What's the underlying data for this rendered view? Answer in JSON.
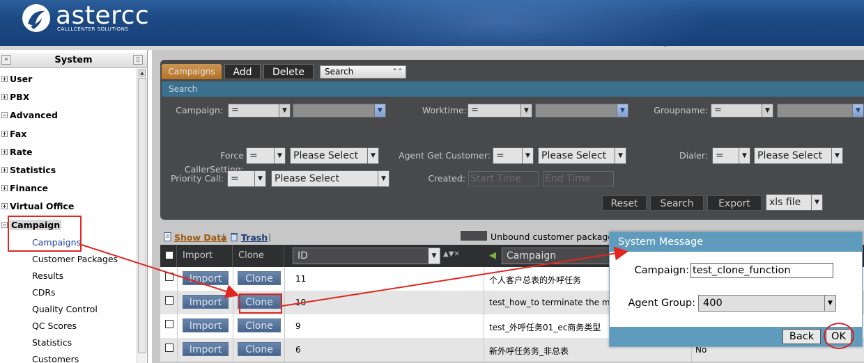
{
  "brand": {
    "name": "astercc",
    "tagline": "CALLLCENTER SOLUTIONS"
  },
  "left_panel": {
    "title": "System",
    "tree": [
      {
        "label": "User",
        "expanded": false
      },
      {
        "label": "PBX",
        "expanded": false
      },
      {
        "label": "Advanced",
        "expanded": true
      },
      {
        "label": "Fax",
        "expanded": false
      },
      {
        "label": "Rate",
        "expanded": false
      },
      {
        "label": "Statistics",
        "expanded": false
      },
      {
        "label": "Finance",
        "expanded": false
      },
      {
        "label": "Virtual Office",
        "expanded": false
      },
      {
        "label": "Campaign",
        "expanded": true
      }
    ],
    "campaign_children": [
      "Campaigns",
      "Customer Packages",
      "Results",
      "CDRs",
      "Quality Control",
      "QC Scores",
      "Statistics",
      "Customers"
    ]
  },
  "tabs": {
    "campaigns": "Campaigns",
    "add": "Add",
    "delete": "Delete",
    "search_select": "Search"
  },
  "search": {
    "bar_label": "Search",
    "campaign_label": "Campaign:",
    "campaign_op": "=",
    "worktime_label": "Worktime:",
    "worktime_op": "=",
    "groupname_label": "Groupname:",
    "groupname_op": "=",
    "force_caller_label": "Force CallerSetting:",
    "force_caller_op": "=",
    "force_caller_value": "Please Select",
    "agent_get_label": "Agent Get Customer:",
    "agent_get_op": "=",
    "agent_get_value": "Please Select",
    "dialer_label": "Dialer:",
    "dialer_op": "=",
    "dialer_value": "Please Select",
    "priority_label": "Priority Call:",
    "priority_op": "=",
    "priority_value": "Please Select",
    "created_label": "Created:",
    "start_placeholder": "Start Time",
    "end_placeholder": "End Time",
    "reset": "Reset",
    "search": "Search",
    "export": "Export",
    "export_format": "xls file"
  },
  "toolbar": {
    "show_data": "Show Data",
    "trash": "Trash",
    "unbound": "Unbound customer package"
  },
  "grid": {
    "headers": {
      "import": "Import",
      "clone": "Clone",
      "id": "ID",
      "campaign": "Campaign"
    },
    "row_buttons": {
      "import": "Import",
      "clone": "Clone"
    },
    "rows": [
      {
        "id": "11",
        "campaign": "个人客户总表的外呼任务",
        "extra": ""
      },
      {
        "id": "10",
        "campaign": "test_how_to terminate the mis",
        "extra": ""
      },
      {
        "id": "9",
        "campaign": "test_外呼任务01_ec商务类型",
        "extra": ""
      },
      {
        "id": "6",
        "campaign": "新外呼任务务_非总表",
        "extra": "No"
      }
    ]
  },
  "dialog": {
    "title": "System Message",
    "campaign_label": "Campaign:",
    "campaign_value": "test_clone_function",
    "group_label": "Agent Group:",
    "group_value": "400",
    "back": "Back",
    "ok": "OK"
  },
  "colors": {
    "highlight": "#e0261f",
    "panel": "#48494b",
    "accent": "#5f9bbd"
  }
}
